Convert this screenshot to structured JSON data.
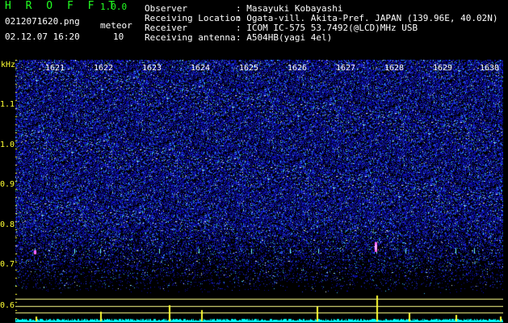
{
  "app": {
    "title": "H R O F F T",
    "version": "1.0.0"
  },
  "file": {
    "name": "0212071620.png",
    "timestamp": "02.12.07 16:20"
  },
  "meteor": {
    "label": "meteor",
    "count": "10"
  },
  "info": [
    {
      "label": "Observer",
      "value": ": Masayuki Kobayashi"
    },
    {
      "label": "Receiving Location",
      "value": ": Ogata-vill. Akita-Pref. JAPAN (139.96E, 40.02N)"
    },
    {
      "label": "Receiver",
      "value": ": ICOM IC-575 53.7492(@LCD)MHz USB"
    },
    {
      "label": "Receiving antenna",
      "value": ": A504HB(yagi 4el)"
    }
  ],
  "spectrogram": {
    "y_unit": "kHz",
    "y_ticks": [
      "1.1",
      "1.0",
      "0.9",
      "0.8",
      "0.7",
      "0.6"
    ],
    "x_ticks": [
      "1621",
      "1622",
      "1623",
      "1624",
      "1625",
      "1626",
      "1627",
      "1628",
      "1629",
      "1630"
    ],
    "background": "#0a0a9a",
    "tick_color": "#ffff33",
    "trace_color": "#00ffff"
  }
}
